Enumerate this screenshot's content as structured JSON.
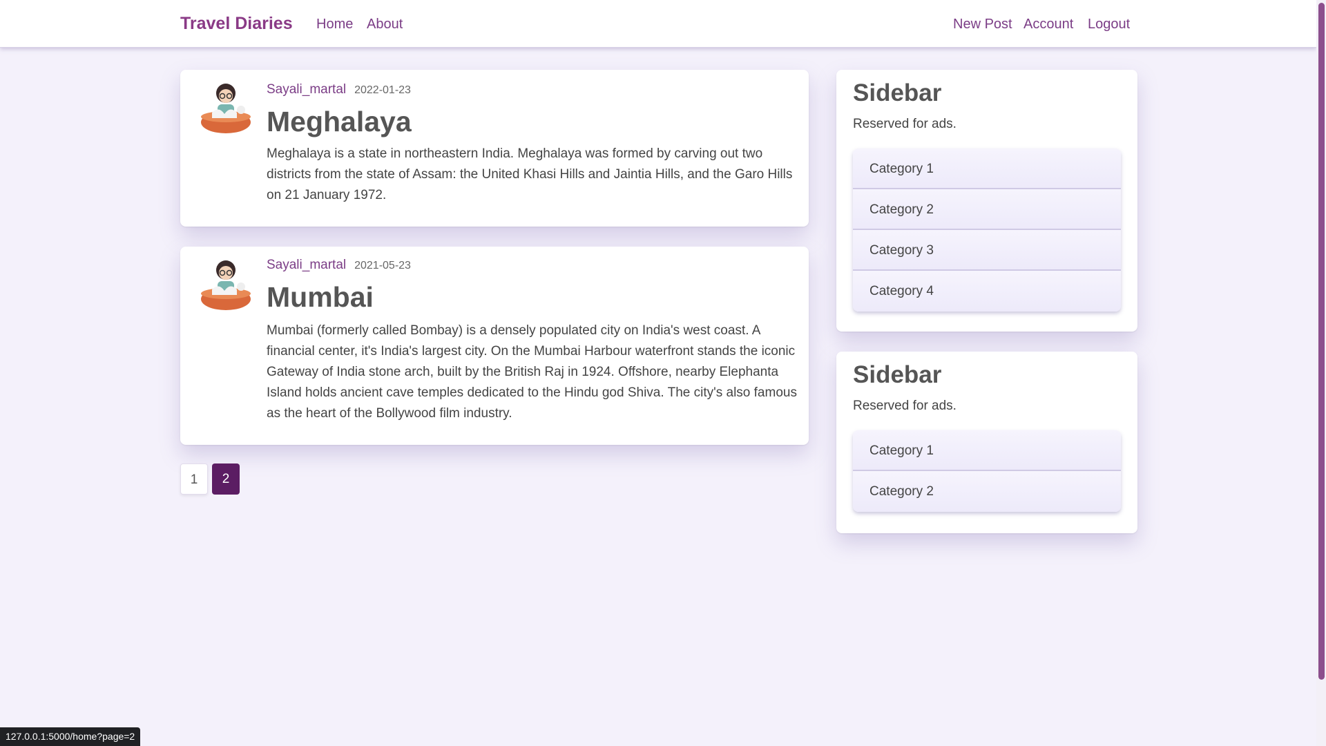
{
  "nav": {
    "brand": "Travel Diaries",
    "home": "Home",
    "about": "About",
    "new_post": "New Post",
    "account": "Account",
    "logout": "Logout"
  },
  "posts": [
    {
      "author": "Sayali_martal",
      "date": "2022-01-23",
      "title": "Meghalaya",
      "body": "Meghalaya is a state in northeastern India. Meghalaya was formed by carving out two districts from the state of Assam: the United Khasi Hills and Jaintia Hills, and the Garo Hills on 21 January 1972."
    },
    {
      "author": "Sayali_martal",
      "date": "2021-05-23",
      "title": "Mumbai",
      "body": "Mumbai (formerly called Bombay) is a densely populated city on India's west coast. A financial center, it's India's largest city. On the Mumbai Harbour waterfront stands the iconic Gateway of India stone arch, built by the British Raj in 1924. Offshore, nearby Elephanta Island holds ancient cave temples dedicated to the Hindu god Shiva. The city's also famous as the heart of the Bollywood film industry."
    }
  ],
  "pagination": {
    "pages": [
      "1",
      "2"
    ],
    "current": "2"
  },
  "sidebars": [
    {
      "title": "Sidebar",
      "subtitle": "Reserved for ads.",
      "categories": [
        "Category 1",
        "Category 2",
        "Category 3",
        "Category 4"
      ]
    },
    {
      "title": "Sidebar",
      "subtitle": "Reserved for ads.",
      "categories": [
        "Category 1",
        "Category 2"
      ]
    }
  ],
  "status_url": "127.0.0.1:5000/home?page=2",
  "colors": {
    "brand": "#8a3a86",
    "link": "#7b3d86",
    "active_page": "#5b1d63",
    "background": "#f4f1fb"
  },
  "icons": {
    "avatar": "girl-avatar-icon"
  }
}
